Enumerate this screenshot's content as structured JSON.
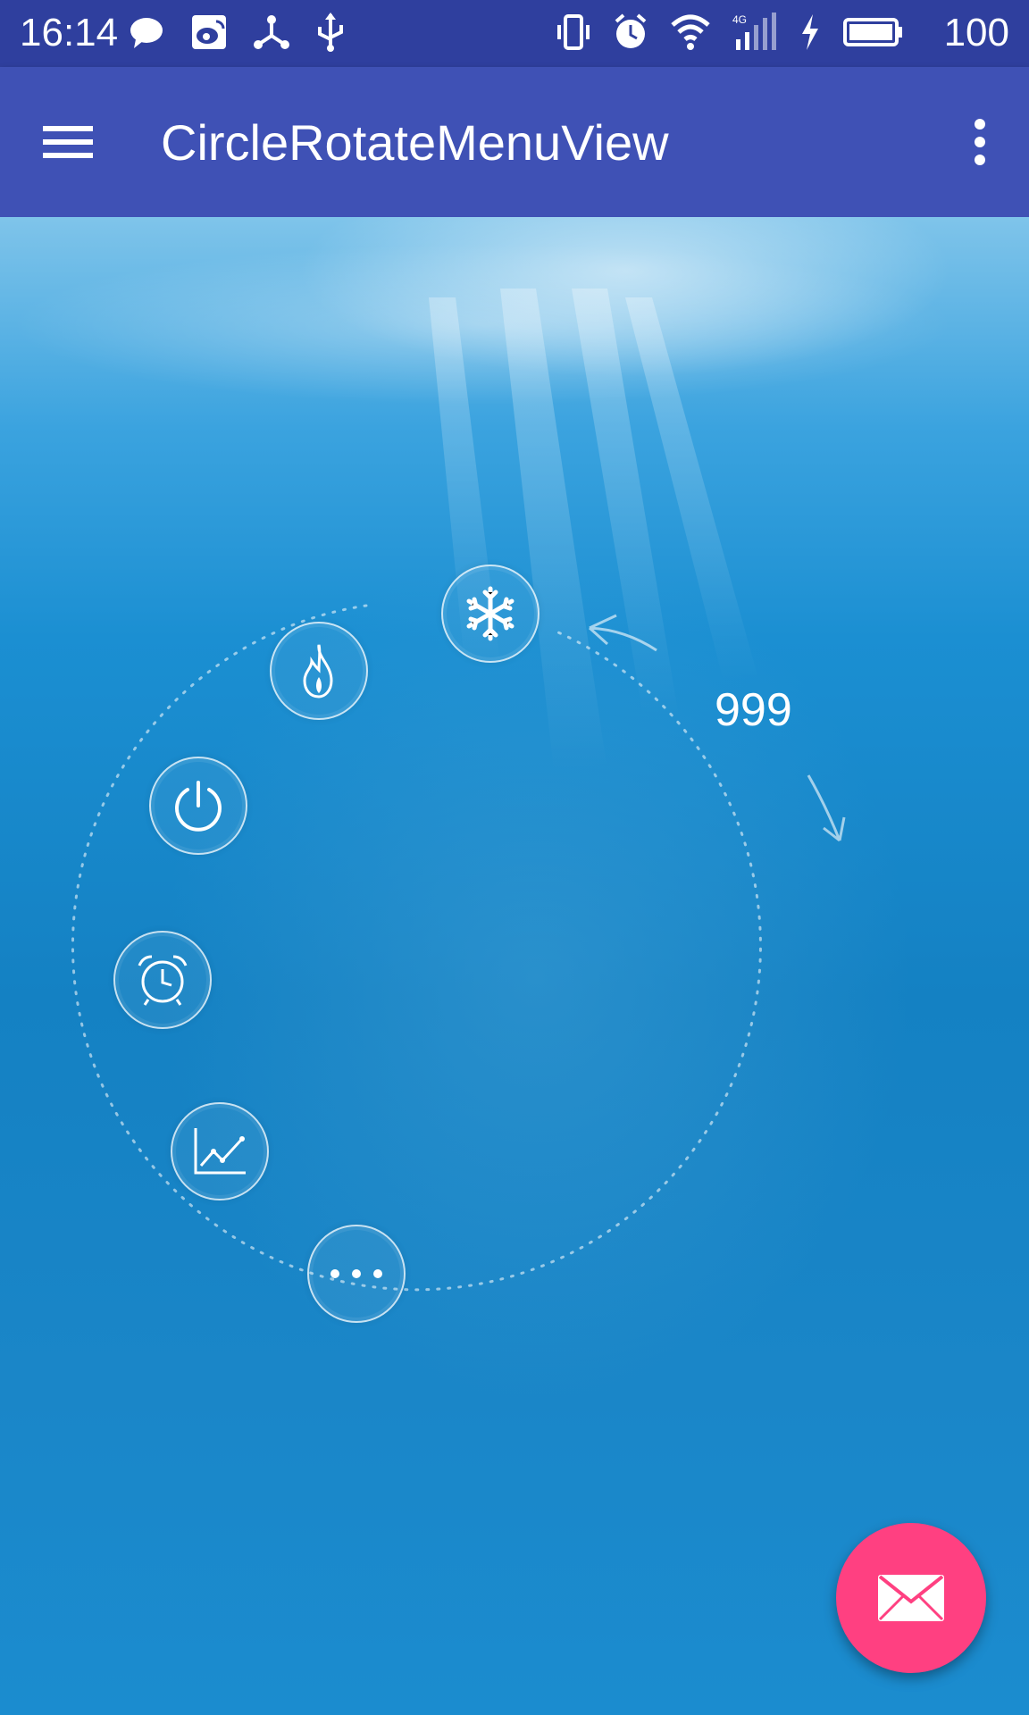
{
  "status_bar": {
    "time": "16:14",
    "left_icons": [
      "chat-icon",
      "weibo-icon",
      "share-nodes-icon",
      "usb-icon"
    ],
    "right_icons": [
      "vibrate-icon",
      "alarm-icon",
      "wifi-icon",
      "signal-4g-icon",
      "charging-icon",
      "battery-icon"
    ],
    "battery_label": "100"
  },
  "app_bar": {
    "title": "CircleRotateMenuView",
    "menu_icon": "hamburger-icon",
    "overflow_icon": "more-vert-icon"
  },
  "circle_menu": {
    "counter": "999",
    "items": [
      {
        "name": "snowflake",
        "icon": "snowflake-icon"
      },
      {
        "name": "flame",
        "icon": "flame-icon"
      },
      {
        "name": "power",
        "icon": "power-icon"
      },
      {
        "name": "alarm",
        "icon": "alarm-clock-icon"
      },
      {
        "name": "chart",
        "icon": "line-chart-icon"
      },
      {
        "name": "more",
        "icon": "more-horiz-icon"
      }
    ]
  },
  "fab": {
    "icon": "mail-icon",
    "color": "#ff4081"
  },
  "colors": {
    "status_bar": "#2f3f9e",
    "app_bar": "#3f51b5",
    "accent": "#ff4081"
  }
}
